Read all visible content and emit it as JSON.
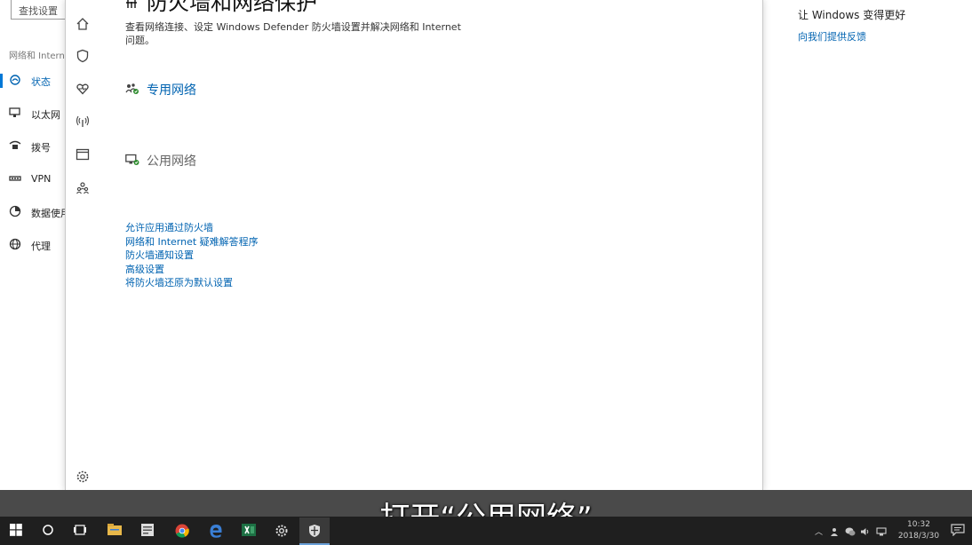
{
  "settings": {
    "search_placeholder": "查找设置",
    "category_title": "网络和 Internet",
    "nav": [
      {
        "label": "状态",
        "icon": "status-icon",
        "active": true
      },
      {
        "label": "以太网",
        "icon": "ethernet-icon"
      },
      {
        "label": "拨号",
        "icon": "dialup-icon"
      },
      {
        "label": "VPN",
        "icon": "vpn-icon"
      },
      {
        "label": "数据使用量",
        "icon": "data-usage-icon"
      },
      {
        "label": "代理",
        "icon": "proxy-icon"
      }
    ],
    "right": {
      "title": "让 Windows 变得更好",
      "link": "向我们提供反馈"
    }
  },
  "defender": {
    "title": "防火墙和网络保护",
    "description": "查看网络连接、设定 Windows Defender 防火墙设置并解决网络和 Internet 问题。",
    "rail_icons": [
      "home-icon",
      "shield-icon",
      "heart-icon",
      "network-antenna-icon",
      "browser-window-icon",
      "family-icon",
      "settings-gear-icon"
    ],
    "networks": {
      "private": "专用网络",
      "public": "公用网络"
    },
    "links": [
      "允许应用通过防火墙",
      "网络和 Internet 疑难解答程序",
      "防火墙通知设置",
      "高级设置",
      "将防火墙还原为默认设置"
    ]
  },
  "subtitle": "打开“公用网络”",
  "taskbar": {
    "clock_time": "10:32",
    "clock_date": "2018/3/30"
  },
  "colors": {
    "accent": "#0078d7",
    "link": "#0063b1",
    "taskbar": "#1f1f1f"
  }
}
